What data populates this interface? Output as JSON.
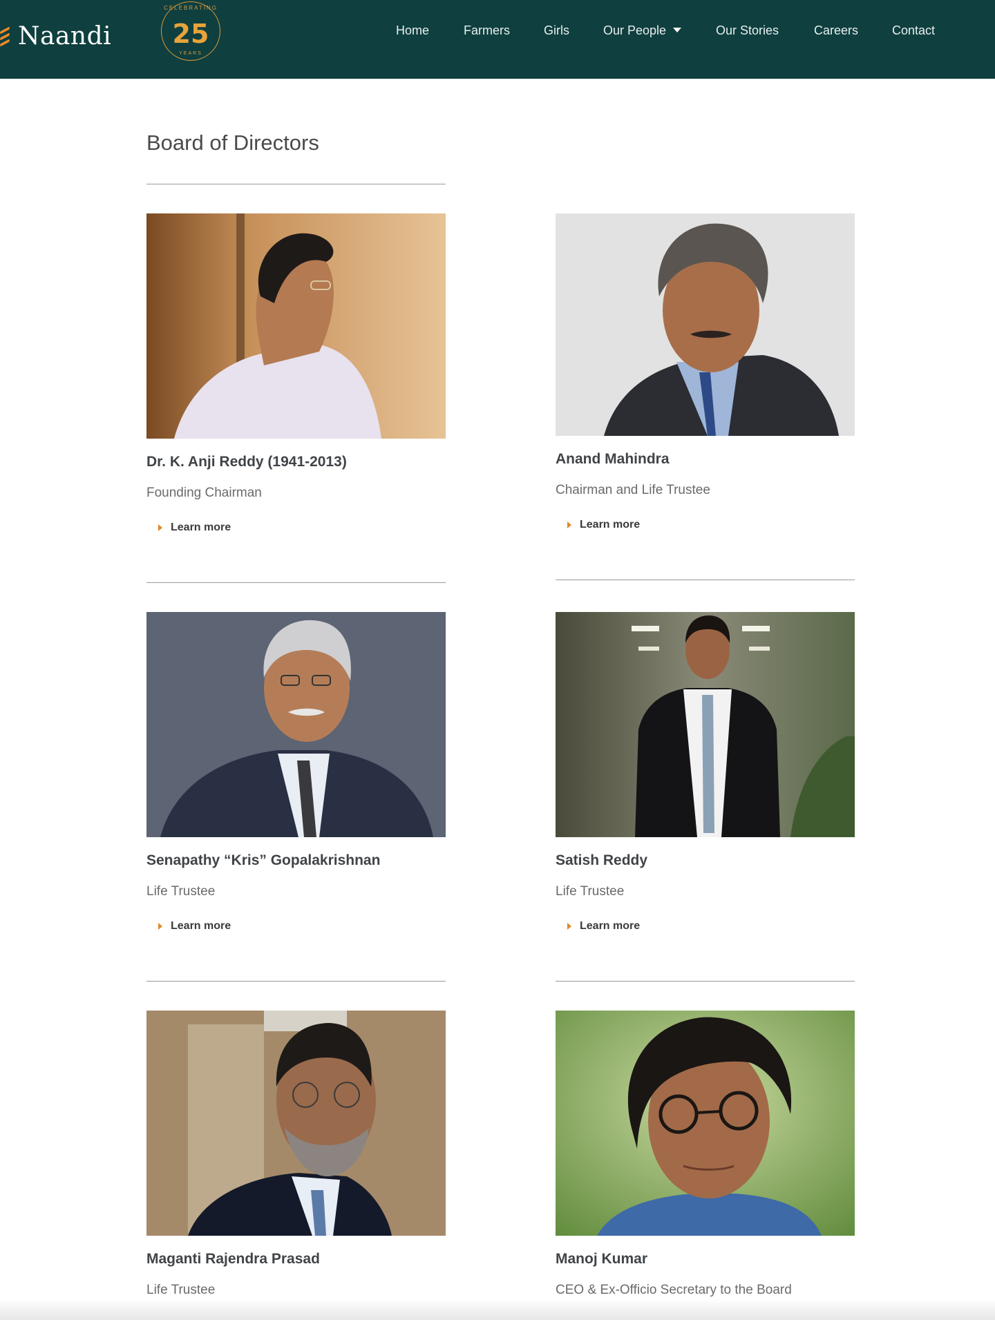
{
  "header": {
    "logo_text": "Naandi",
    "badge": {
      "top": "CELEBRATING",
      "number": "25",
      "bottom": "YEARS"
    },
    "nav": [
      {
        "label": "Home"
      },
      {
        "label": "Farmers"
      },
      {
        "label": "Girls"
      },
      {
        "label": "Our People",
        "dropdown": true
      },
      {
        "label": "Our Stories"
      },
      {
        "label": "Careers"
      },
      {
        "label": "Contact"
      }
    ]
  },
  "main": {
    "title": "Board of Directors",
    "learn_more": "Learn more",
    "members": [
      {
        "name": "Dr. K. Anji Reddy (1941-2013)",
        "role": "Founding Chairman"
      },
      {
        "name": "Anand Mahindra",
        "role": "Chairman and Life Trustee"
      },
      {
        "name": "Senapathy “Kris” Gopalakrishnan",
        "role": "Life Trustee"
      },
      {
        "name": "Satish Reddy",
        "role": "Life Trustee"
      },
      {
        "name": "Maganti Rajendra Prasad",
        "role": "Life Trustee"
      },
      {
        "name": "Manoj Kumar",
        "role": "CEO & Ex-Officio Secretary to the Board"
      }
    ]
  },
  "colors": {
    "header_bg": "#0f3f3f",
    "accent": "#e08a2a"
  }
}
